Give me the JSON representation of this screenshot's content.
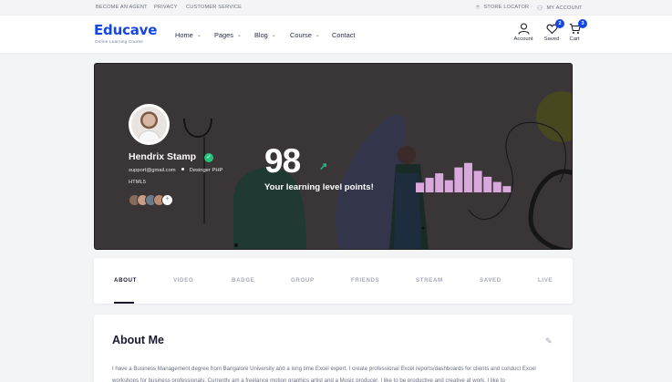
{
  "topbar": {
    "become_agent": "BECOME AN AGENT",
    "privacy": "PRIVACY",
    "customer_service": "CUSTOMER SERVICE",
    "store_locator": "STORE LOCATOR",
    "my_account": "MY ACCOUNT"
  },
  "header": {
    "logo": "Educave",
    "tagline": "Online Learning Course",
    "nav": [
      {
        "label": "Home"
      },
      {
        "label": "Pages"
      },
      {
        "label": "Blog"
      },
      {
        "label": "Course"
      },
      {
        "label": "Contact"
      }
    ],
    "account_label": "Account",
    "saved_label": "Saved",
    "saved_count": "2",
    "cart_label": "Cart",
    "cart_count": "3"
  },
  "profile": {
    "name": "Hendrix Stamp",
    "email": "support@gmail.com",
    "skills_line": "Desinger  PHP",
    "skills_line2": "HTML5",
    "friends_more": "+",
    "points": "98",
    "points_label": "Your learning level points!",
    "level_bars": [
      0.28,
      0.42,
      0.55,
      0.35,
      0.72,
      0.85,
      0.62,
      0.45,
      0.3,
      0.18
    ]
  },
  "tabs": [
    {
      "label": "ABOUT",
      "active": true
    },
    {
      "label": "VIDEO"
    },
    {
      "label": "BADGE"
    },
    {
      "label": "GROUP"
    },
    {
      "label": "FRIENDS"
    },
    {
      "label": "STREAM"
    },
    {
      "label": "SAVED"
    },
    {
      "label": "LIVE"
    }
  ],
  "about": {
    "title": "About Me",
    "text": "I have a Business Management degree from Bangalore University and a long time Excel expert. I create professional Excel reports/dashboards for clients and conduct Excel workshops for business professionals. Currently am a freelance motion graphics artist and a Music producer. I like to be productive and creative at work. I like to"
  },
  "colors": {
    "brand": "#1446e6",
    "hero_bg": "#3a3637",
    "bars": "#d9a8dc",
    "verified": "#24c27a"
  }
}
